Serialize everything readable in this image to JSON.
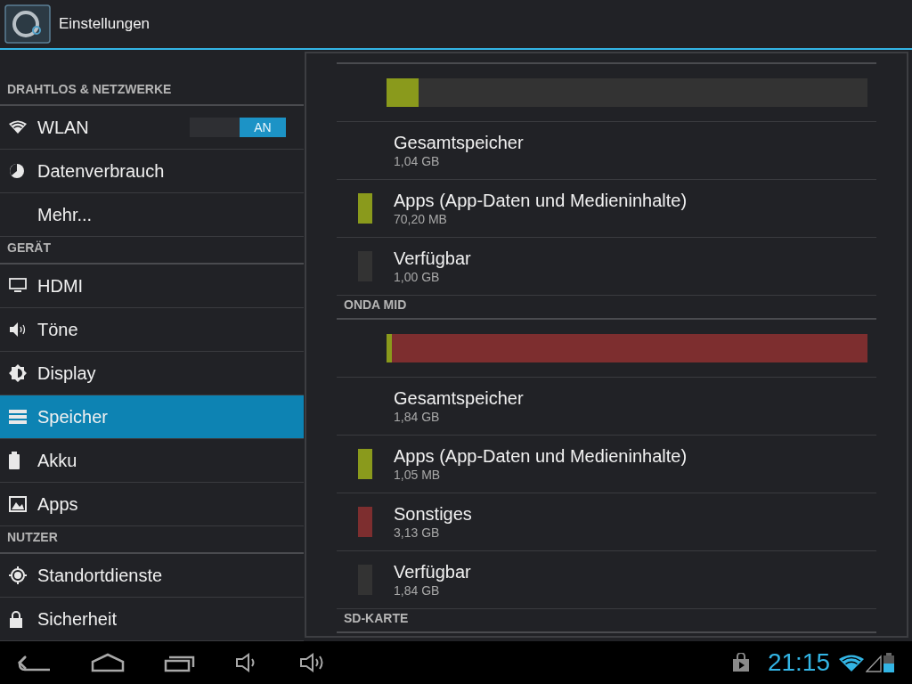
{
  "action_bar": {
    "title": "Einstellungen"
  },
  "sidebar": {
    "items": [
      {
        "kind": "header",
        "label": "DRAHTLOS & NETZWERKE"
      },
      {
        "kind": "item",
        "label": "WLAN",
        "selected": false,
        "toggle": {
          "label": "AN",
          "on": true
        }
      },
      {
        "kind": "item",
        "label": "Datenverbrauch",
        "selected": false
      },
      {
        "kind": "item",
        "label": "Mehr...",
        "selected": false
      },
      {
        "kind": "header",
        "label": "GERÄT"
      },
      {
        "kind": "item",
        "label": "HDMI",
        "selected": false
      },
      {
        "kind": "item",
        "label": "Töne",
        "selected": false
      },
      {
        "kind": "item",
        "label": "Display",
        "selected": false
      },
      {
        "kind": "item",
        "label": "Speicher",
        "selected": true
      },
      {
        "kind": "item",
        "label": "Akku",
        "selected": false
      },
      {
        "kind": "item",
        "label": "Apps",
        "selected": false
      },
      {
        "kind": "header",
        "label": "NUTZER"
      },
      {
        "kind": "item",
        "label": "Standortdienste",
        "selected": false
      },
      {
        "kind": "item",
        "label": "Sicherheit",
        "selected": false
      }
    ]
  },
  "storage": {
    "sections": [
      {
        "segments": [
          {
            "color": "#8a9a1c",
            "level": 0.066
          }
        ],
        "rows": [
          {
            "kind": "total",
            "label": "Gesamtspeicher",
            "value": "1,04 GB"
          },
          {
            "kind": "category",
            "label": "Apps (App-Daten und Medieninhalte)",
            "value": "70,20 MB",
            "color": "#8a9a1c"
          },
          {
            "kind": "category",
            "label": "Verfügbar",
            "value": "1,00 GB",
            "color": "#333333"
          }
        ]
      },
      {
        "header": "ONDA MID",
        "segments": [
          {
            "color": "#8a9a1c",
            "level": 0.011
          },
          {
            "color": "#7d2e2f",
            "level": 0.989
          }
        ],
        "rows": [
          {
            "kind": "total",
            "label": "Gesamtspeicher",
            "value": "1,84 GB"
          },
          {
            "kind": "category",
            "label": "Apps (App-Daten und Medieninhalte)",
            "value": "1,05 MB",
            "color": "#8a9a1c"
          },
          {
            "kind": "category",
            "label": "Sonstiges",
            "value": "3,13 GB",
            "color": "#7d2e2f"
          },
          {
            "kind": "category",
            "label": "Verfügbar",
            "value": "1,84 GB",
            "color": "#333333"
          }
        ]
      },
      {
        "header": "SD-KARTE"
      }
    ]
  },
  "status_bar": {
    "time": "21:15"
  }
}
